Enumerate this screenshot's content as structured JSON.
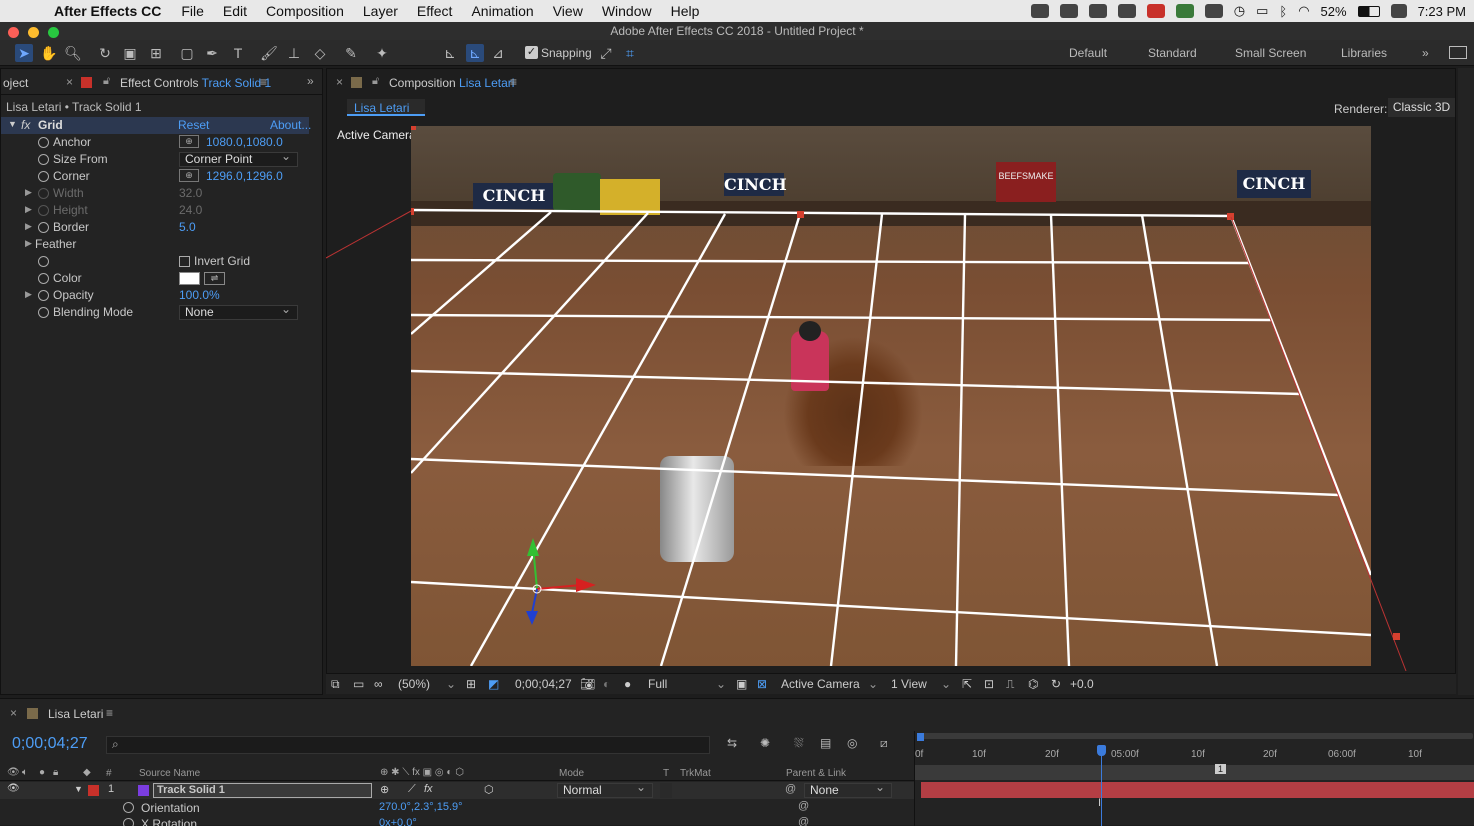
{
  "menubar": {
    "app_name": "After Effects CC",
    "items": [
      "File",
      "Edit",
      "Composition",
      "Layer",
      "Effect",
      "Animation",
      "View",
      "Window",
      "Help"
    ],
    "battery": "52%",
    "clock": "7:23 PM"
  },
  "window_title": "Adobe After Effects CC 2018 - Untitled Project *",
  "toolbar": {
    "snapping_label": "Snapping",
    "snapping_checked": true,
    "workspaces": [
      "Default",
      "Standard",
      "Small Screen",
      "Libraries"
    ]
  },
  "project_tab": "oject",
  "effect_controls": {
    "tab_label": "Effect Controls",
    "tab_layer": "Track Solid 1",
    "header": "Lisa Letari • Track Solid 1",
    "effect_name": "Grid",
    "reset_label": "Reset",
    "about_label": "About...",
    "props": {
      "anchor": {
        "name": "Anchor",
        "value": "1080.0,1080.0"
      },
      "size_from": {
        "name": "Size From",
        "value": "Corner Point"
      },
      "corner": {
        "name": "Corner",
        "value": "1296.0,1296.0"
      },
      "width": {
        "name": "Width",
        "value": "32.0"
      },
      "height": {
        "name": "Height",
        "value": "24.0"
      },
      "border": {
        "name": "Border",
        "value": "5.0"
      },
      "feather": {
        "name": "Feather"
      },
      "invert": {
        "name": "Invert Grid"
      },
      "color": {
        "name": "Color"
      },
      "opacity": {
        "name": "Opacity",
        "value": "100.0%"
      },
      "blending": {
        "name": "Blending Mode",
        "value": "None"
      }
    }
  },
  "composition": {
    "tab_label": "Composition",
    "tab_name": "Lisa Letari",
    "subtab": "Lisa Letari",
    "renderer_label": "Renderer:",
    "renderer_value": "Classic 3D",
    "view_label": "Active Camera",
    "banners": [
      "CINCH",
      "CINCH",
      "BEEFSMAKE",
      "CINCH"
    ],
    "footer": {
      "zoom": "(50%)",
      "timecode": "0;00;04;27",
      "resolution": "Full",
      "camera": "Active Camera",
      "views": "1 View",
      "exposure": "+0.0"
    }
  },
  "timeline": {
    "tab_name": "Lisa Letari",
    "timecode": "0;00;04;27",
    "columns": {
      "source": "Source Name",
      "mode": "Mode",
      "t": "T",
      "trkmat": "TrkMat",
      "parent": "Parent & Link"
    },
    "ruler": [
      "0f",
      "10f",
      "20f",
      "05:00f",
      "10f",
      "20f",
      "06:00f",
      "10f"
    ],
    "layer": {
      "index": "1",
      "name": "Track Solid 1",
      "mode": "Normal",
      "parent": "None"
    },
    "subprops": [
      {
        "name": "Orientation",
        "value": "270.0°,2.3°,15.9°"
      },
      {
        "name": "X Rotation",
        "value": "0x+0.0°"
      }
    ],
    "marker_label": "1"
  }
}
